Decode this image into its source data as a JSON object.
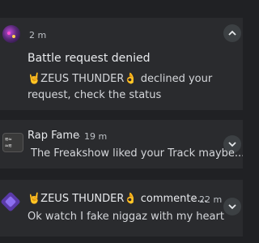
{
  "notifications": [
    {
      "time": "2 m",
      "title": "Battle request denied",
      "body": "🤘ZEUS THUNDER👌 declined your request, check the status"
    },
    {
      "app": "Rap Fame",
      "separator": "·",
      "time": "19 m",
      "body": "The Freakshow liked your Track maybe..."
    },
    {
      "title": "🤘ZEUS THUNDER👌 commente...",
      "separator": "·",
      "time": "22 m",
      "body": "Ok watch I fake niggaz with my heart"
    }
  ]
}
